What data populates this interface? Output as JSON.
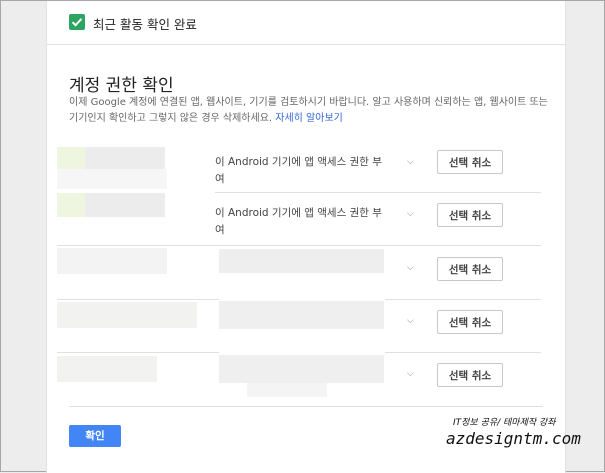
{
  "header": {
    "completed_label": "최근 활동 확인 완료",
    "check_color": "#2ba561"
  },
  "section": {
    "title": "계정 권한 확인",
    "description": "이제 Google 계정에 연결된 앱, 웹사이트, 기기를 검토하시기 바랍니다. 알고 사용하며 신뢰하는 앱, 웹사이트 또는 기기인지 확인하고 그렇지 않은 경우 삭제하세요.",
    "learn_more": "자세히 알아보기"
  },
  "items": [
    {
      "permission": "이 Android 기기에 앱 액세스 권한 부여",
      "action": "선택 취소"
    },
    {
      "permission": "이 Android 기기에 앱 액세스 권한 부여",
      "action": "선택 취소"
    },
    {
      "permission": "",
      "action": "선택 취소"
    },
    {
      "permission": "",
      "action": "선택 취소"
    },
    {
      "permission": "",
      "action": "선택 취소"
    }
  ],
  "footer": {
    "confirm_label": "확인",
    "accent_color": "#4285f4"
  },
  "watermark": {
    "line1": "IT정보 공유/ 테마제작 강좌",
    "line2": "azdesigntm.com"
  }
}
